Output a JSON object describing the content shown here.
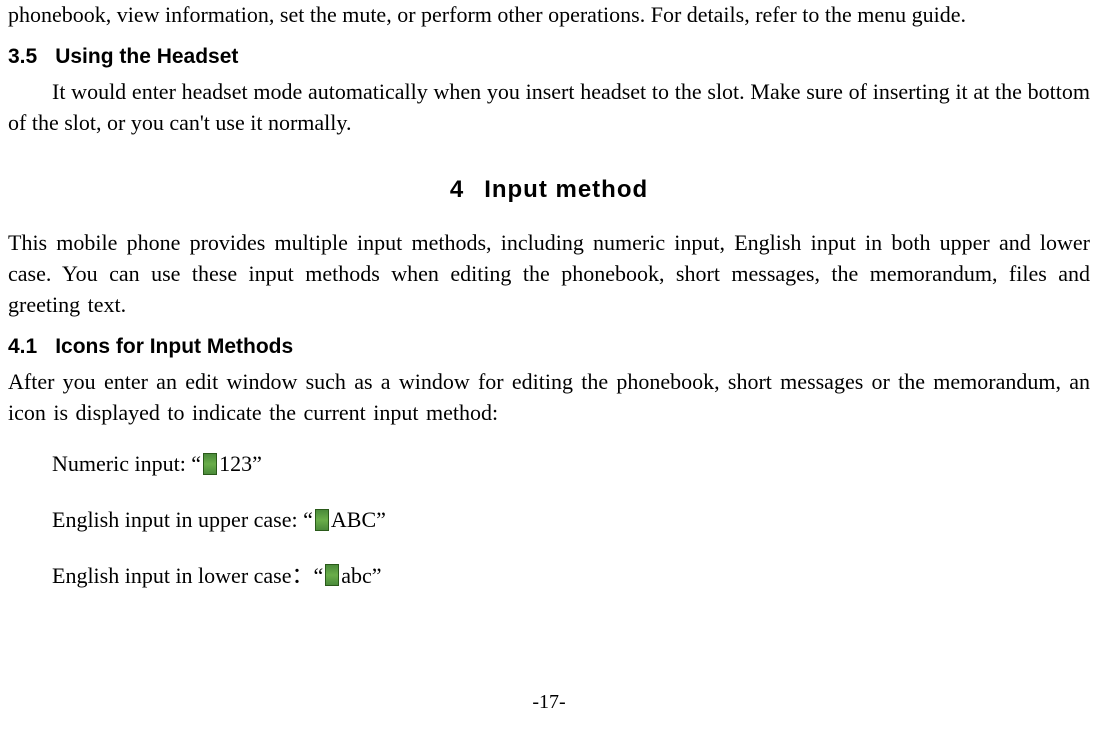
{
  "intro_fragment": "phonebook, view information, set the mute, or perform other operations. For details, refer to the menu guide.",
  "section35": {
    "num": "3.5",
    "title": "Using the Headset",
    "body": "It would enter headset mode automatically when you insert headset to the slot. Make sure of inserting it at the bottom of the slot, or you can't use it normally."
  },
  "chapter4": {
    "num": "4",
    "title": "Input method",
    "intro": "This mobile phone provides multiple input methods, including numeric input, English input in both upper and lower case. You can use these input methods when editing the phonebook, short messages, the memorandum, files and greeting text."
  },
  "section41": {
    "num": "4.1",
    "title": "Icons for Input Methods",
    "body": "After you enter an edit window such as a window for editing the phonebook, short messages or the memorandum, an icon is displayed to indicate the current input method:",
    "numeric_label": "Numeric input: “",
    "numeric_suffix": "123”",
    "upper_label": "English input in upper case: “",
    "upper_suffix": " ABC”",
    "lower_label": "English input in lower case：“",
    "lower_suffix": " abc”"
  },
  "page_number": "-17-"
}
